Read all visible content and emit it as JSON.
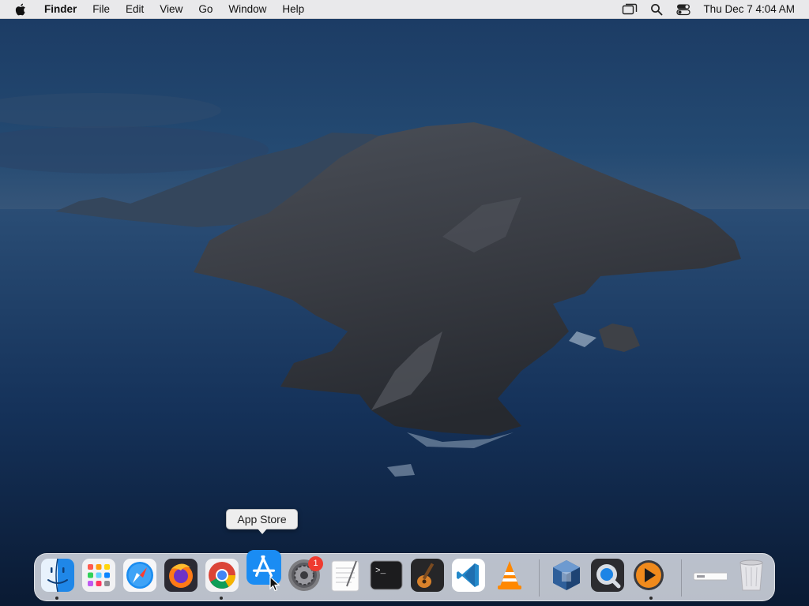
{
  "menubar": {
    "apple_icon": "apple-logo-icon",
    "app_name": "Finder",
    "menus": [
      "File",
      "Edit",
      "View",
      "Go",
      "Window",
      "Help"
    ],
    "status_icons": [
      "screen-mirroring-icon",
      "search-icon",
      "control-center-icon"
    ],
    "clock": "Thu Dec 7  4:04 AM"
  },
  "tooltip": {
    "text": "App Store"
  },
  "dock": {
    "apps": [
      {
        "name": "Finder",
        "icon": "finder-icon",
        "running": true
      },
      {
        "name": "Launchpad",
        "icon": "launchpad-icon",
        "running": false
      },
      {
        "name": "Safari",
        "icon": "safari-icon",
        "running": false
      },
      {
        "name": "Firefox",
        "icon": "firefox-icon",
        "running": false
      },
      {
        "name": "Google Chrome",
        "icon": "chrome-icon",
        "running": true
      },
      {
        "name": "App Store",
        "icon": "app-store-icon",
        "running": false
      },
      {
        "name": "System Preferences",
        "icon": "system-preferences-icon",
        "running": false,
        "badge": "1"
      },
      {
        "name": "TextEdit",
        "icon": "textedit-icon",
        "running": false
      },
      {
        "name": "Terminal",
        "icon": "terminal-icon",
        "running": false
      },
      {
        "name": "GarageBand",
        "icon": "garageband-icon",
        "running": false
      },
      {
        "name": "Visual Studio Code",
        "icon": "vscode-icon",
        "running": false
      },
      {
        "name": "VLC",
        "icon": "vlc-icon",
        "running": false
      },
      {
        "name": "VirtualBox",
        "icon": "virtualbox-icon",
        "running": false
      },
      {
        "name": "QuickTime Player",
        "icon": "quicktime-icon",
        "running": false
      },
      {
        "name": "Infuse",
        "icon": "media-player-icon",
        "running": true
      }
    ],
    "right": [
      {
        "name": "Downloads",
        "icon": "downloads-stack-icon"
      },
      {
        "name": "Trash",
        "icon": "trash-icon"
      }
    ]
  }
}
